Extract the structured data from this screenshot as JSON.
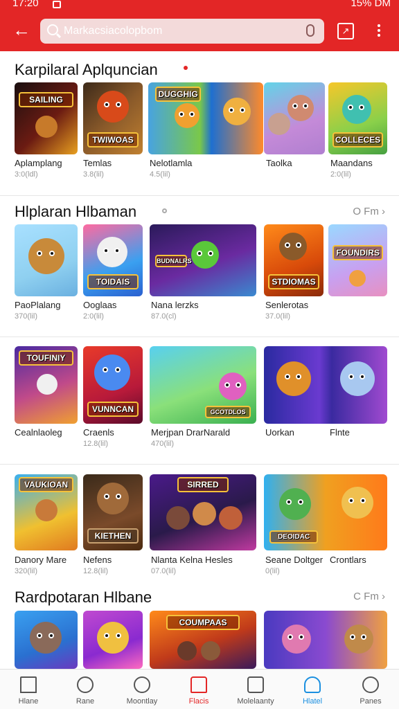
{
  "status": {
    "time": "17:20",
    "right": "15% DM"
  },
  "search": {
    "placeholder": "Markacsiacolopbom"
  },
  "sections": [
    {
      "title": "Karpilaral Aplquncian",
      "more": "",
      "apps": [
        {
          "name": "Aplamplang",
          "size": "3:0(ldl)",
          "art": "SAILING"
        },
        {
          "name": "Temlas",
          "size": "3.8(lil)",
          "art": "TWIWOAS"
        },
        {
          "name": "Nelotlamla",
          "size": "4.5(lil)",
          "art": "DUGGHIG"
        },
        {
          "name": "Taolka",
          "size": "",
          "art": ""
        },
        {
          "name": "Maandans",
          "size": "2:0(lil)",
          "art": "COLLECES"
        }
      ]
    },
    {
      "title": "Hlplaran Hlbaman",
      "more": "O Fm",
      "apps": [
        {
          "name": "PaoPlalang",
          "size": "370(lil)",
          "art": ""
        },
        {
          "name": "Ooglaas",
          "size": "2:0(lil)",
          "art": "TOIDAIS"
        },
        {
          "name": "Nana lerzks",
          "size": "87.0(cl)",
          "art": "BUDNALRS"
        },
        {
          "name": "Senlerotas",
          "size": "37.0(lil)",
          "art": "STDIOMAS"
        },
        {
          "name": "",
          "size": "",
          "art": "FOUNDIRS"
        }
      ]
    },
    {
      "title": "",
      "more": "",
      "apps": [
        {
          "name": "Cealnlaoleg",
          "size": "",
          "art": "TOUFINIY"
        },
        {
          "name": "Craenls",
          "size": "12.8(lil)",
          "art": "VUNNCAN"
        },
        {
          "name": "Merjpan DrarNarald",
          "size": "470(lil)",
          "art": "GCOTDLOS"
        },
        {
          "name": "Uorkan",
          "size": "",
          "art": ""
        },
        {
          "name": "Flnte",
          "size": "",
          "art": ""
        }
      ]
    },
    {
      "title": "",
      "more": "",
      "apps": [
        {
          "name": "Danory Mare",
          "size": "320(lil)",
          "art": "VAUKIOAN"
        },
        {
          "name": "Nefens",
          "size": "12.8(lil)",
          "art": "KIETHEN"
        },
        {
          "name": "Nlanta Kelna Hesles",
          "size": "07.0(lil)",
          "art": "SIRRED"
        },
        {
          "name": "Seane Doltger",
          "size": "0(lil)",
          "art": "DEOIDAC"
        },
        {
          "name": "Crontlars",
          "size": "",
          "art": ""
        }
      ]
    },
    {
      "title": "Rardpotaran Hlbane",
      "more": "C Fm",
      "apps": [
        {
          "name": "",
          "size": "",
          "art": ""
        },
        {
          "name": "",
          "size": "",
          "art": ""
        },
        {
          "name": "",
          "size": "",
          "art": "COUMPAAS"
        },
        {
          "name": "",
          "size": "",
          "art": ""
        },
        {
          "name": "",
          "size": "",
          "art": ""
        }
      ]
    }
  ],
  "nav": [
    {
      "label": "Hlane"
    },
    {
      "label": "Rane"
    },
    {
      "label": "Moontlay"
    },
    {
      "label": "Flacis"
    },
    {
      "label": "Molelaanty"
    },
    {
      "label": "Hlatel"
    },
    {
      "label": "Panes"
    }
  ],
  "colors": {
    "brand": "#e32626",
    "nav_active_red": "#e32626",
    "nav_active_blue": "#1a8fe0"
  }
}
